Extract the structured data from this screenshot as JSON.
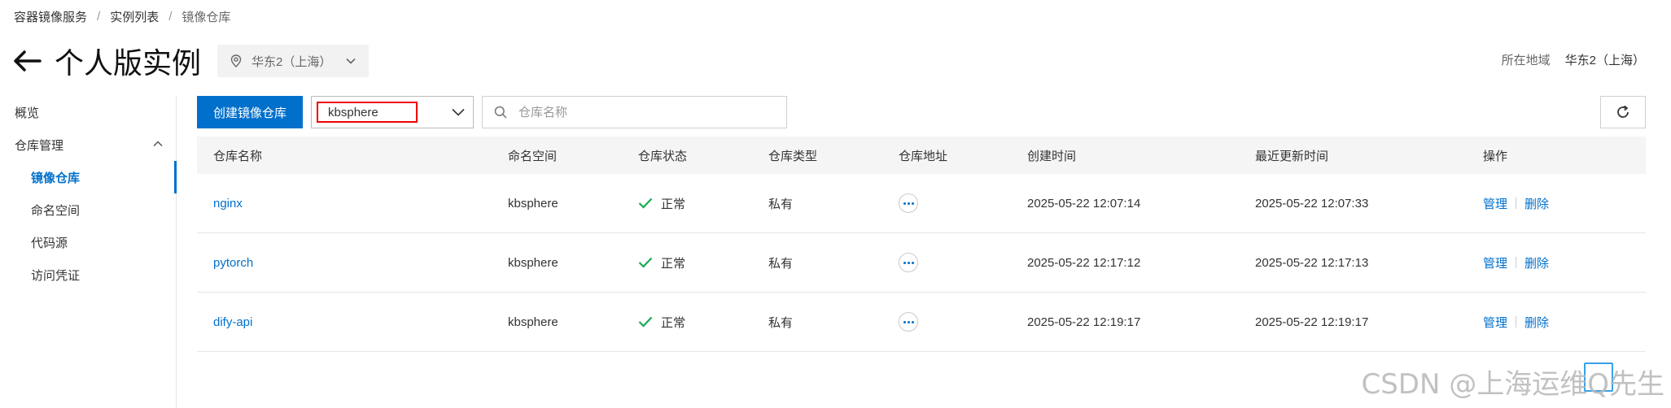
{
  "breadcrumb": [
    "容器镜像服务",
    "实例列表",
    "镜像仓库"
  ],
  "page_title": "个人版实例",
  "region_select": "华东2（上海）",
  "region_info": {
    "label": "所在地域",
    "value": "华东2（上海）"
  },
  "sidebar": {
    "items": [
      {
        "label": "概览"
      },
      {
        "label": "仓库管理"
      },
      {
        "label": "镜像仓库"
      },
      {
        "label": "命名空间"
      },
      {
        "label": "代码源"
      },
      {
        "label": "访问凭证"
      }
    ]
  },
  "toolbar": {
    "create_label": "创建镜像仓库",
    "namespace_value": "kbsphere",
    "search_placeholder": "仓库名称"
  },
  "table": {
    "headers": [
      "仓库名称",
      "命名空间",
      "仓库状态",
      "仓库类型",
      "仓库地址",
      "创建时间",
      "最近更新时间",
      "操作"
    ],
    "rows": [
      {
        "name": "nginx",
        "namespace": "kbsphere",
        "status": "正常",
        "type": "私有",
        "created": "2025-05-22 12:07:14",
        "updated": "2025-05-22 12:07:33",
        "op_manage": "管理",
        "op_delete": "删除"
      },
      {
        "name": "pytorch",
        "namespace": "kbsphere",
        "status": "正常",
        "type": "私有",
        "created": "2025-05-22 12:17:12",
        "updated": "2025-05-22 12:17:13",
        "op_manage": "管理",
        "op_delete": "删除"
      },
      {
        "name": "dify-api",
        "namespace": "kbsphere",
        "status": "正常",
        "type": "私有",
        "created": "2025-05-22 12:19:17",
        "updated": "2025-05-22 12:19:17",
        "op_manage": "管理",
        "op_delete": "删除"
      }
    ]
  },
  "watermark": "CSDN @上海运维Q先生",
  "colors": {
    "accent": "#0070cc",
    "success": "#1aaa55",
    "highlight": "#e00000"
  }
}
